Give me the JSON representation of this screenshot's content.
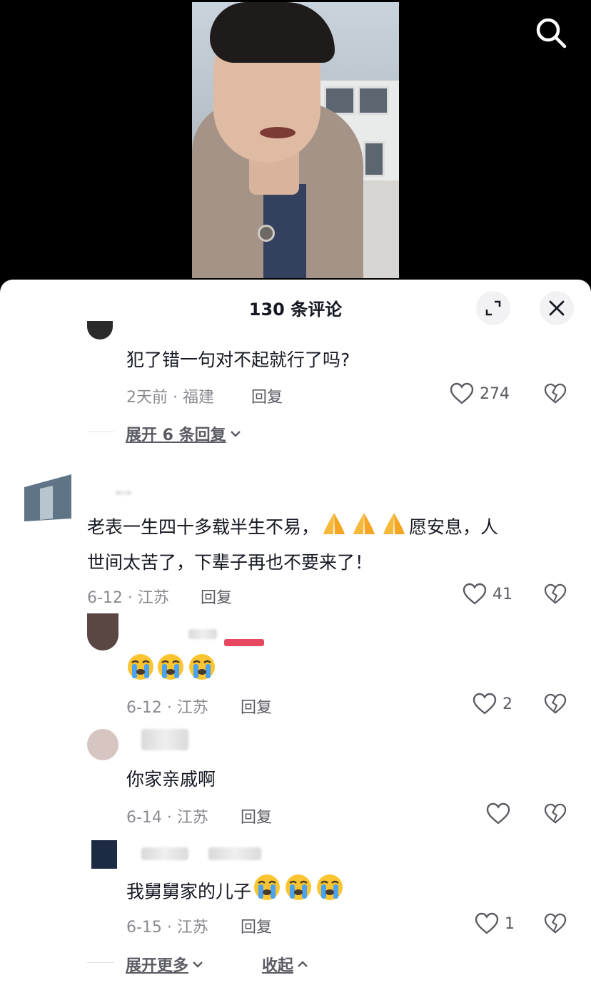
{
  "header": {
    "comment_count_title": "130 条评论"
  },
  "comments": [
    {
      "text": "犯了错一句对不起就行了吗?",
      "time_location": "2天前 · 福建",
      "reply_label": "回复",
      "likes": "274",
      "expand_label": "展开 6 条回复"
    },
    {
      "text_line1_a": "老表一生四十多载半生不易，",
      "text_line1_b": "愿安息，人",
      "text_line2": "世间太苦了，下辈子再也不要来了！",
      "time_location": "6-12 · 江苏",
      "reply_label": "回复",
      "likes": "41",
      "replies": [
        {
          "time_location": "6-12 · 江苏",
          "reply_label": "回复",
          "likes": "2"
        },
        {
          "text": "你家亲戚啊",
          "time_location": "6-14 · 江苏",
          "reply_label": "回复",
          "likes": ""
        },
        {
          "text": "我舅舅家的儿子",
          "time_location": "6-15 · 江苏",
          "reply_label": "回复",
          "likes": "1"
        }
      ],
      "expand_more_label": "展开更多",
      "collapse_label": "收起"
    }
  ],
  "icons": {
    "search": "search-icon",
    "expand": "fullscreen-icon",
    "close": "close-icon",
    "like": "heart-icon",
    "dislike": "broken-heart-icon",
    "pray": "pray-emoji",
    "cry": "crying-emoji"
  }
}
